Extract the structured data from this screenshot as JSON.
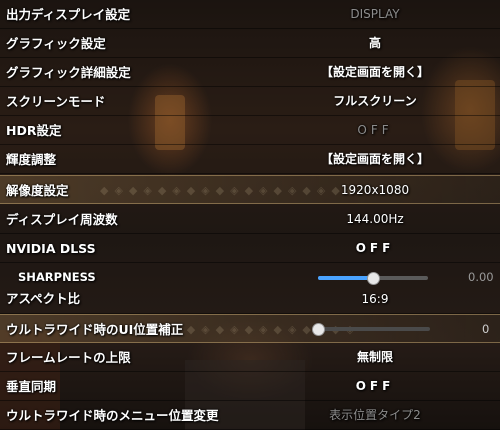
{
  "settings": {
    "display_mode": {
      "label": "出力ディスプレイ設定",
      "value": "DISPLAY"
    },
    "graphics": {
      "label": "グラフィック設定",
      "value": "高"
    },
    "graphics_detail": {
      "label": "グラフィック詳細設定",
      "value": "【設定画面を開く】"
    },
    "screen_mode": {
      "label": "スクリーンモード",
      "value": "フルスクリーン"
    },
    "hdr": {
      "label": "HDR設定",
      "value": "OFF"
    },
    "brightness": {
      "label": "輝度調整",
      "value": "【設定画面を開く】"
    },
    "resolution": {
      "label": "解像度設定",
      "value": "1920x1080"
    },
    "refresh_rate": {
      "label": "ディスプレイ周波数",
      "value": "144.00Hz"
    },
    "dlss": {
      "label": "NVIDIA DLSS",
      "value": "OFF"
    },
    "sharpness": {
      "label": "SHARPNESS",
      "value": "0.00",
      "level": 0.5
    },
    "aspect": {
      "label": "アスペクト比",
      "value": "16:9"
    },
    "ultrawide_ui": {
      "label": "ウルトラワイド時のUI位置補正",
      "value": "0",
      "level": 0.0
    },
    "framerate": {
      "label": "フレームレートの上限",
      "value": "無制限"
    },
    "vsync": {
      "label": "垂直同期",
      "value": "OFF"
    },
    "ultrawide_menu": {
      "label": "ウルトラワイド時のメニュー位置変更",
      "value": "表示位置タイプ2"
    }
  },
  "colors": {
    "accent": "#4aa3ff",
    "highlight": "#6e5537"
  },
  "decor": {
    "pattern_text": "◆◈◆◈◆◈◆◈◆◈◆◈◆◈◆◈◆◈"
  }
}
